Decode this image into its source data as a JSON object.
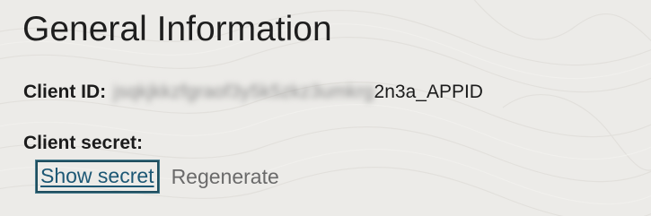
{
  "section": {
    "title": "General Information"
  },
  "client_id": {
    "label": "Client ID:",
    "value_redacted": "jsqkjkkzfgraof3y5k5zkz3umkrg",
    "value_visible": "2n3a_APPID"
  },
  "client_secret": {
    "label": "Client secret:",
    "show_label": "Show secret",
    "regenerate_label": "Regenerate"
  },
  "colors": {
    "background": "#ecebe8",
    "link": "#1c5774",
    "focus_border": "#1f4e5f",
    "disabled_text": "#6a6a6a"
  }
}
